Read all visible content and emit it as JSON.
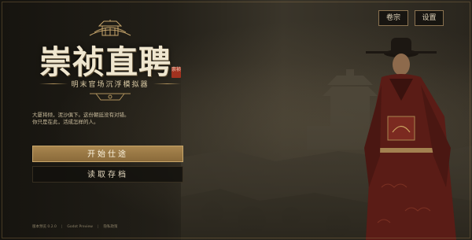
{
  "logo": {
    "title": "崇祯直聘",
    "seal": "崇祯",
    "subtitle": "明末官场沉浮模拟器"
  },
  "top_buttons": {
    "button_1": "卷宗",
    "button_2": "设置"
  },
  "intro_lines": [
    "大厦将倾，泥沙俱下。这份朝廷没有对错。",
    "你只是在此，活成怎样的人。"
  ],
  "main_buttons": {
    "start": "开始仕途",
    "load": "读取存档"
  },
  "footer": {
    "version": "版本预览 0.2.0",
    "build": "Godot Preview",
    "notice": "隐私政策"
  }
}
